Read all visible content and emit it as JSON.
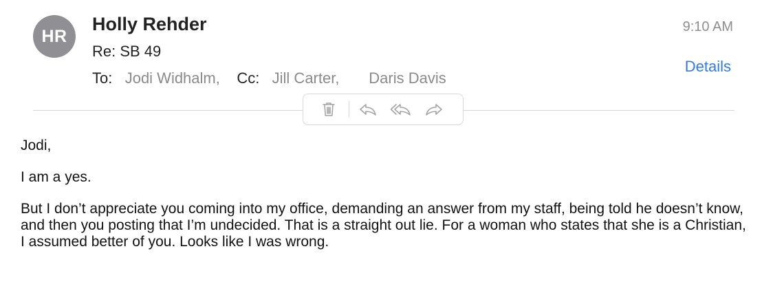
{
  "header": {
    "avatar_initials": "HR",
    "sender": "Holly Rehder",
    "subject": "Re: SB 49",
    "to_label": "To:",
    "to": [
      "Jodi Widhalm,"
    ],
    "cc_label": "Cc:",
    "cc": [
      "Jill Carter,",
      "Daris Davis"
    ],
    "time": "9:10 AM",
    "details_label": "Details"
  },
  "toolbar": {
    "icons": [
      "trash-icon",
      "reply-icon",
      "reply-all-icon",
      "forward-icon"
    ]
  },
  "body": {
    "greeting": "Jodi,",
    "line1": "I am a yes.",
    "line2": "But I don’t appreciate you coming into my office, demanding an answer from my staff, being told he doesn’t know, and then you posting that I’m undecided. That is a straight out lie. For a woman who states that she is a Christian, I assumed better of you. Looks like I was wrong."
  },
  "colors": {
    "avatar_bg": "#8f8f94",
    "link": "#2f7ae5",
    "muted_text": "#8a8a8a"
  }
}
